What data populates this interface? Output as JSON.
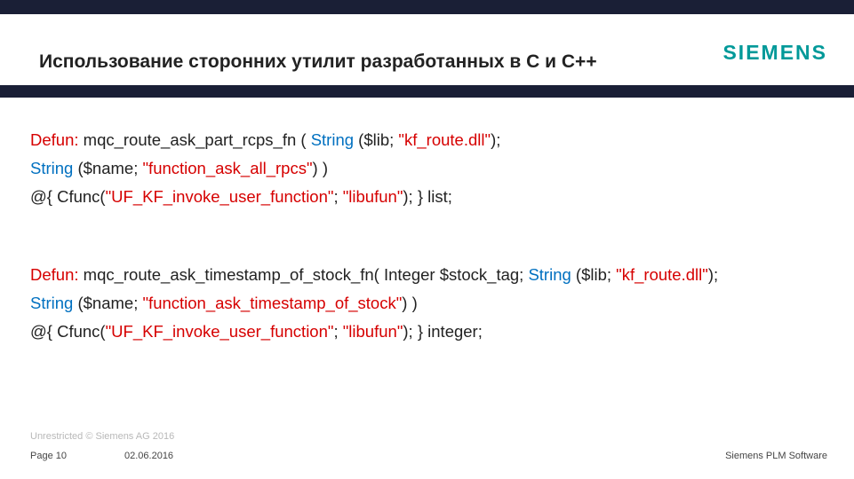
{
  "header": {
    "title": "Использование сторонних утилит разработанных в С и С++",
    "logo": "SIEMENS"
  },
  "code": {
    "block1": {
      "l1": {
        "defun": "Defun:",
        "fn": " mqc_route_ask_part_rcps_fn ( ",
        "type1": "String",
        "paren1": " ($lib; ",
        "str1": "\"kf_route.dll\"",
        "end1": ");"
      },
      "l2": {
        "type2": "String",
        "paren2": " ($name; ",
        "str2": "\"function_ask_all_rpcs\"",
        "end2": ") )"
      },
      "l3": {
        "pre": "@{ Cfunc(",
        "str3": "\"UF_KF_invoke_user_function\"",
        "mid": "; ",
        "str4": "\"libufun\"",
        "end3": "); } list;"
      }
    },
    "block2": {
      "l1": {
        "defun": "Defun:",
        "fn": " mqc_route_ask_timestamp_of_stock_fn( Integer $stock_tag; ",
        "type1": "String",
        "paren1": " ($lib; ",
        "str1": "\"kf_route.dll\"",
        "end1": ");"
      },
      "l2": {
        "type2": "String",
        "paren2": " ($name; ",
        "str2": "\"function_ask_timestamp_of_stock\"",
        "end2": ") )"
      },
      "l3": {
        "pre": "@{ Cfunc(",
        "str3": "\"UF_KF_invoke_user_function\"",
        "mid": "; ",
        "str4": "\"libufun\"",
        "end3": "); } integer;"
      }
    }
  },
  "footer": {
    "copyright": "Unrestricted © Siemens AG 2016",
    "page": "Page 10",
    "date": "02.06.2016",
    "brand": "Siemens PLM Software"
  }
}
